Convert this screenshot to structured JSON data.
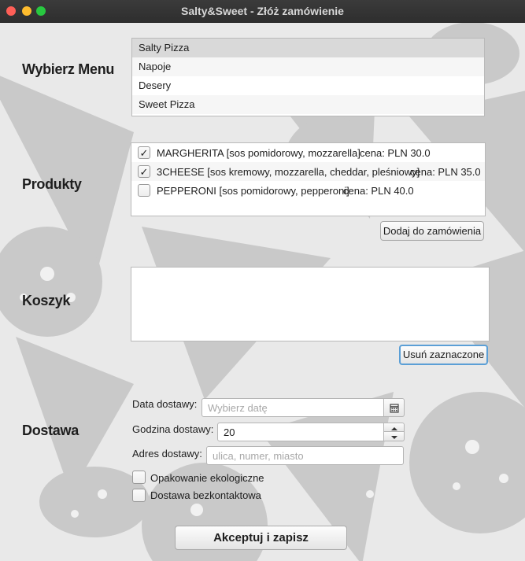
{
  "window": {
    "title": "Salty&Sweet - Złóż zamówienie"
  },
  "sections": {
    "menu": "Wybierz Menu",
    "products": "Produkty",
    "cart": "Koszyk",
    "delivery": "Dostawa"
  },
  "menu_list": {
    "items": [
      "Salty Pizza",
      "Napoje",
      "Desery",
      "Sweet Pizza"
    ],
    "selected": "Salty Pizza"
  },
  "products": [
    {
      "name": "MARGHERITA [sos pomidorowy, mozzarella]",
      "price": "cena: PLN 30.0",
      "checked": true
    },
    {
      "name": "3CHEESE [sos kremowy, mozzarella, cheddar, pleśniowy]",
      "price": "cena: PLN 35.0",
      "checked": true
    },
    {
      "name": "PEPPERONI [sos pomidorowy, pepperoni]",
      "price": "cena: PLN 40.0",
      "checked": false
    }
  ],
  "buttons": {
    "add": "Dodaj do zamówienia",
    "remove": "Usuń zaznaczone",
    "accept": "Akceptuj i zapisz"
  },
  "cart": {
    "items": []
  },
  "delivery": {
    "date_label": "Data dostawy:",
    "date_placeholder": "Wybierz datę",
    "date_value": "",
    "hour_label": "Godzina dostawy:",
    "hour_value": "20",
    "address_label": "Adres dostawy:",
    "address_placeholder": "ulica, numer, miasto",
    "address_value": "",
    "eco_label": "Opakowanie ekologiczne",
    "eco_checked": false,
    "contactless_label": "Dostawa bezkontaktowa",
    "contactless_checked": false
  },
  "icons": {
    "checkmark": "✓",
    "calendar": "calendar-icon",
    "spin_up": "chevron-up-icon",
    "spin_down": "chevron-down-icon"
  },
  "colors": {
    "background": "#e9e9e9",
    "pattern": "#c7c7c7",
    "focus_ring": "#5b9fd6",
    "title_bar": "#333333"
  }
}
